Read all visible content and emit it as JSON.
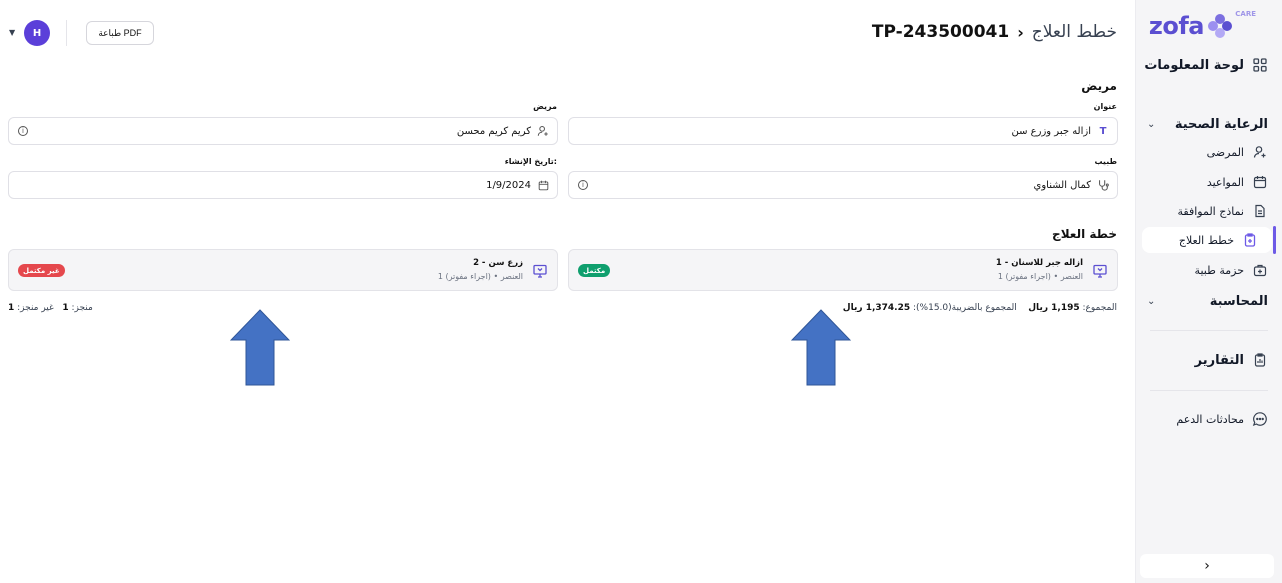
{
  "app": {
    "logo_text": "zofa",
    "logo_suffix": "CARE"
  },
  "sidebar": {
    "dashboard": "لوحة المعلومات",
    "healthcare": "الرعاية الصحية",
    "items": [
      {
        "label": "المرضى",
        "icon": "patient-icon"
      },
      {
        "label": "المواعيد",
        "icon": "calendar-icon"
      },
      {
        "label": "نماذج الموافقة",
        "icon": "document-icon"
      },
      {
        "label": "خطط العلاج",
        "icon": "treatment-plan-icon",
        "active": true
      },
      {
        "label": "حزمة طبية",
        "icon": "medical-kit-icon"
      }
    ],
    "accounting": "المحاسبة",
    "reports": "التقارير",
    "support": "محادثات الدعم",
    "collapse": "›"
  },
  "header": {
    "breadcrumb_root": "خطط العلاج",
    "breadcrumb_sep": "›",
    "plan_id": "TP-243500041",
    "pdf_button": "طباعة PDF",
    "avatar_initial": "H"
  },
  "form": {
    "section_title": "مريض",
    "title_label": "عنوان",
    "title_value": "ازاله جبر وزرع سن",
    "patient_label": "مريض",
    "patient_value": "كريم كريم محسن",
    "doctor_label": "طبيب",
    "doctor_value": "كمال الشناوي",
    "created_label": "تاريخ الإنشاء:",
    "created_value": "1/9/2024"
  },
  "plan": {
    "section_title": "خطة العلاج",
    "cards": [
      {
        "name": "1 - ازاله جبر للاسنان",
        "sub": "1 العنصر • (اجراء مفوتر)",
        "status": "مكتمل",
        "status_color": "#0f9f6e"
      },
      {
        "name": "2 - زرع سن",
        "sub": "1 العنصر • (اجراء مفوتر)",
        "status": "غير مكتمل",
        "status_color": "#e5484d"
      }
    ],
    "total_label": "المجموع:",
    "total_value": "1,195 ريال",
    "total_tax_label": "المجموع بالضريبة(15.0%):",
    "total_tax_value": "1,374.25 ريال",
    "done_label": "منجز:",
    "done_value": "1",
    "not_done_label": "غير منجز:",
    "not_done_value": "1"
  },
  "colors": {
    "accent": "#6d5ae6",
    "arrow": "#4472c4"
  }
}
